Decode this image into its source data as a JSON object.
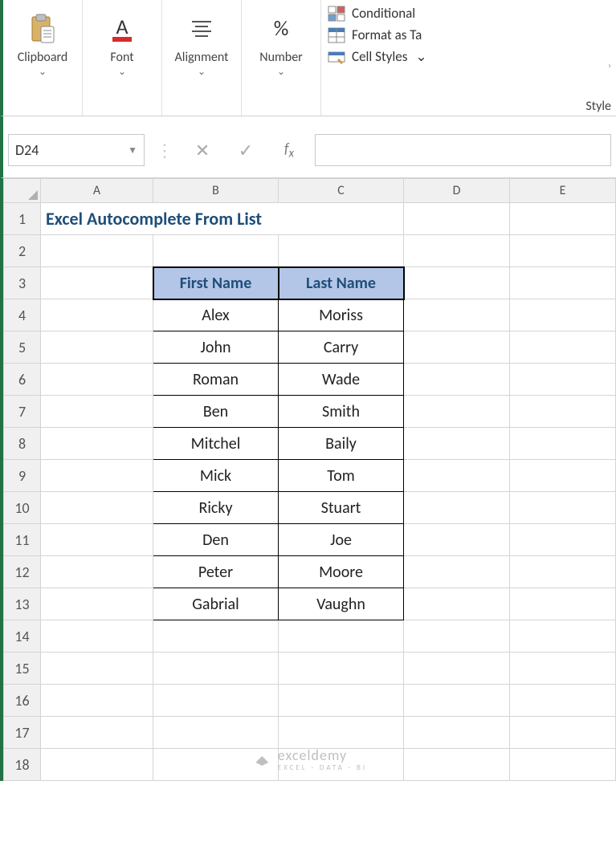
{
  "ribbon": {
    "clipboard_label": "Clipboard",
    "font_label": "Font",
    "alignment_label": "Alignment",
    "number_label": "Number",
    "conditional_label": "Conditional",
    "format_table_label": "Format as Ta",
    "cell_styles_label": "Cell Styles",
    "styles_group_caption": "Style"
  },
  "formula_bar": {
    "name_box": "D24",
    "formula": ""
  },
  "columns": [
    "A",
    "B",
    "C",
    "D",
    "E"
  ],
  "rows": [
    "1",
    "2",
    "3",
    "4",
    "5",
    "6",
    "7",
    "8",
    "9",
    "10",
    "11",
    "12",
    "13",
    "14",
    "15",
    "16",
    "17",
    "18"
  ],
  "title_text": "Excel Autocomplete From List",
  "table": {
    "headers": {
      "first": "First Name",
      "last": "Last Name"
    },
    "rows": [
      {
        "first": "Alex",
        "last": "Moriss"
      },
      {
        "first": "John",
        "last": "Carry"
      },
      {
        "first": "Roman",
        "last": "Wade"
      },
      {
        "first": "Ben",
        "last": "Smith"
      },
      {
        "first": "Mitchel",
        "last": "Baily"
      },
      {
        "first": "Mick",
        "last": "Tom"
      },
      {
        "first": "Ricky",
        "last": "Stuart"
      },
      {
        "first": "Den",
        "last": "Joe"
      },
      {
        "first": "Peter",
        "last": "Moore"
      },
      {
        "first": "Gabrial",
        "last": "Vaughn"
      }
    ]
  },
  "watermark": {
    "brand": "exceldemy",
    "tagline": "EXCEL · DATA · BI"
  }
}
